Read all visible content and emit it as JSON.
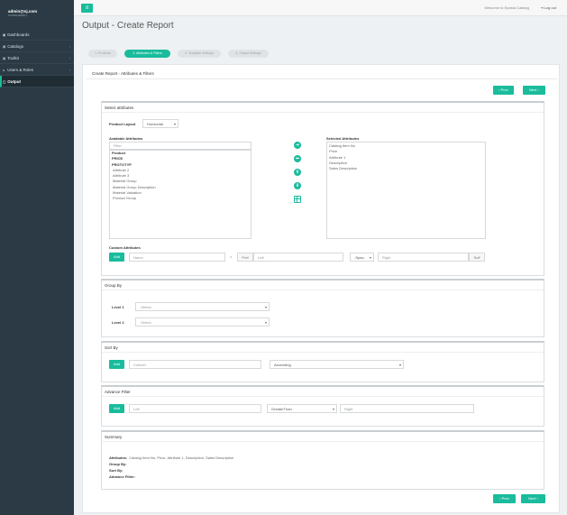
{
  "user": {
    "name": "admin@nj.com",
    "subtitle": "SYSTEM ADMIN ▾"
  },
  "sidebar": {
    "items": [
      {
        "icon": "▦",
        "label": "Dashboards",
        "chevron": ""
      },
      {
        "icon": "▤",
        "label": "Catalogs",
        "chevron": "‹"
      },
      {
        "icon": "▤",
        "label": "Toolkit",
        "chevron": "‹"
      },
      {
        "icon": "●",
        "label": "Users & Roles",
        "chevron": "‹"
      },
      {
        "icon": "▢",
        "label": "Output",
        "chevron": ""
      }
    ]
  },
  "topbar": {
    "menu_icon": "≡",
    "welcome": "Welcome to Epasta Catalog",
    "logout": "⇥ Log out"
  },
  "page": {
    "title": "Output - Create Report"
  },
  "wizard": {
    "steps": [
      "1. Products",
      "2. Attributes & Filters",
      "3. Template Settings",
      "4. Output Settings"
    ],
    "active_step": 2
  },
  "main": {
    "title": "Create Report - Attributes & Filters",
    "prev": "‹ Prev",
    "next": "Next ›"
  },
  "select_attributes": {
    "title": "Select attributes",
    "layout_label": "Product Layout",
    "layout_value": "Horizontal",
    "available_label": "Available Attributes",
    "filter_placeholder": "Filter",
    "available": [
      "Product",
      "PRICE",
      "PROTOTYP",
      "Attribute 2",
      "Attribute 3",
      "Material Group",
      "Material Group Description",
      "Material Valuation",
      "Product Group"
    ],
    "selected_label": "Selected Attributes",
    "selected": [
      "Catalog Item No",
      "Price",
      "Attribute 1",
      "Description",
      "Sales Description"
    ],
    "custom_label": "Custom Attributes",
    "add": "Add",
    "name_placeholder": "Name",
    "equals": "=",
    "prefix_addon": "Pref",
    "left_placeholder": "Left",
    "operator_value": "-Spac-",
    "right_placeholder": "Right",
    "suffix_addon": "Suff"
  },
  "group_by": {
    "title": "Group By",
    "level1_label": "Level 1",
    "level1_value": "-Select-",
    "level2_label": "Level 2",
    "level2_value": "-Select-"
  },
  "sort_by": {
    "title": "Sort By",
    "add": "Add",
    "column_placeholder": "Column",
    "order_value": "Ascending"
  },
  "advance_filter": {
    "title": "Advance Filter",
    "add": "Add",
    "left_placeholder": "Left",
    "operator_value": "GreaterThan",
    "right_placeholder": "Right"
  },
  "summary": {
    "title": "Summary",
    "rows": [
      {
        "key": "Attributes:",
        "value": "Catalog Item No, Price, Attribute 1, Description, Sales Description"
      },
      {
        "key": "Group By:",
        "value": ""
      },
      {
        "key": "Sort By:",
        "value": ""
      },
      {
        "key": "Advance Filter:",
        "value": ""
      }
    ]
  },
  "colors": {
    "accent": "#1abc9c",
    "sidebar": "#2b3a44"
  }
}
